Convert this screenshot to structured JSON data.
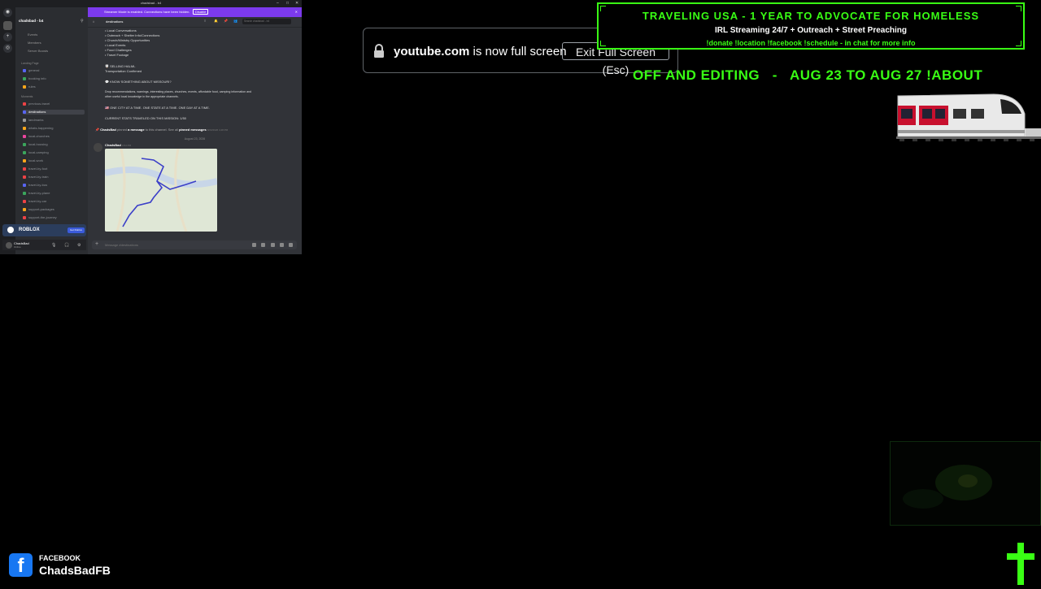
{
  "discord": {
    "window_title": "chadsbad - b4",
    "guild_name": "chadsbad - b4",
    "nav": [
      "Events",
      "Members",
      "Server Boosts"
    ],
    "categories": [
      "Landing Page",
      "Moments"
    ],
    "channels_top": [
      "general",
      "booking info",
      "rules"
    ],
    "channels": [
      "previous-travel",
      "destinations",
      "landmarks",
      "whats-happening",
      "local-churches",
      "local-housing",
      "local-camping",
      "local-work",
      "travel-by-foot",
      "travel-by-train",
      "travel-by-bus",
      "travel-by-plane",
      "travel-by-car",
      "support-packages",
      "support-the-journey"
    ],
    "active_channel": "destinations",
    "notice": "Streamer Mode is enabled. Connections have been hidden.",
    "notice_btn": "Disable",
    "channel_header": "destinations",
    "search_placeholder": "Search chadsbad - b4",
    "message_lines": [
      "• Local Conversations",
      "• Outreach + Shelter Info/Connections",
      "• Church/Ministry Opportunities",
      "• Local Events",
      "• Food Challenges",
      "• Travel Footage"
    ],
    "status_line1": "SELLING HALML",
    "status_line2": "Transportation Confirmed",
    "ask_line": "KNOW SOMETHING ABOUT MISSOURI?",
    "drop_line1": "Drop recommendations, warnings, interesting places, churches, events, affordable food, camping information and",
    "drop_line2": "other useful local knowledge in the appropriate channels.",
    "motto": "ONE CITY AT A TIME. ONE STATE AT A TIME. ONE DAY AT A TIME.",
    "current_stats": "CURRENT STATS TRAVELED ON THIS MISSION: 1/50",
    "pin_user": "ChadsBad",
    "pin_mid": "pinned",
    "pin_msg": "a message",
    "pin_to": "to this channel. See all",
    "pin_link": "pinned messages",
    "pin_time": "8/23/2026 4:48 PM",
    "date_divider": "August 23, 2026",
    "author": "ChadsBad",
    "author_time": "4:54 PM",
    "input_placeholder": "Message #destinations",
    "roblox_name": "ROBLOX",
    "roblox_btn": "Get Roblox",
    "username": "ChadsBad",
    "user_status": "Online"
  },
  "youtube_popup": {
    "domain": "youtube.com",
    "message": "is now full screen",
    "exit_button": "Exit Full Screen (Esc)"
  },
  "overlay": {
    "banner_title": "TRAVELING USA - 1 YEAR TO ADVOCATE FOR HOMELESS",
    "banner_subtitle": "IRL Streaming 24/7 + Outreach + Street Preaching",
    "banner_commands": "!donate !location !facebook !schedule - in chat for more info",
    "status": "OFF AND EDITING   -   AUG 23 TO AUG 27 !ABOUT",
    "facebook_label": "FACEBOOK",
    "facebook_name": "ChadsBadFB",
    "accent_color": "#39ff14"
  }
}
